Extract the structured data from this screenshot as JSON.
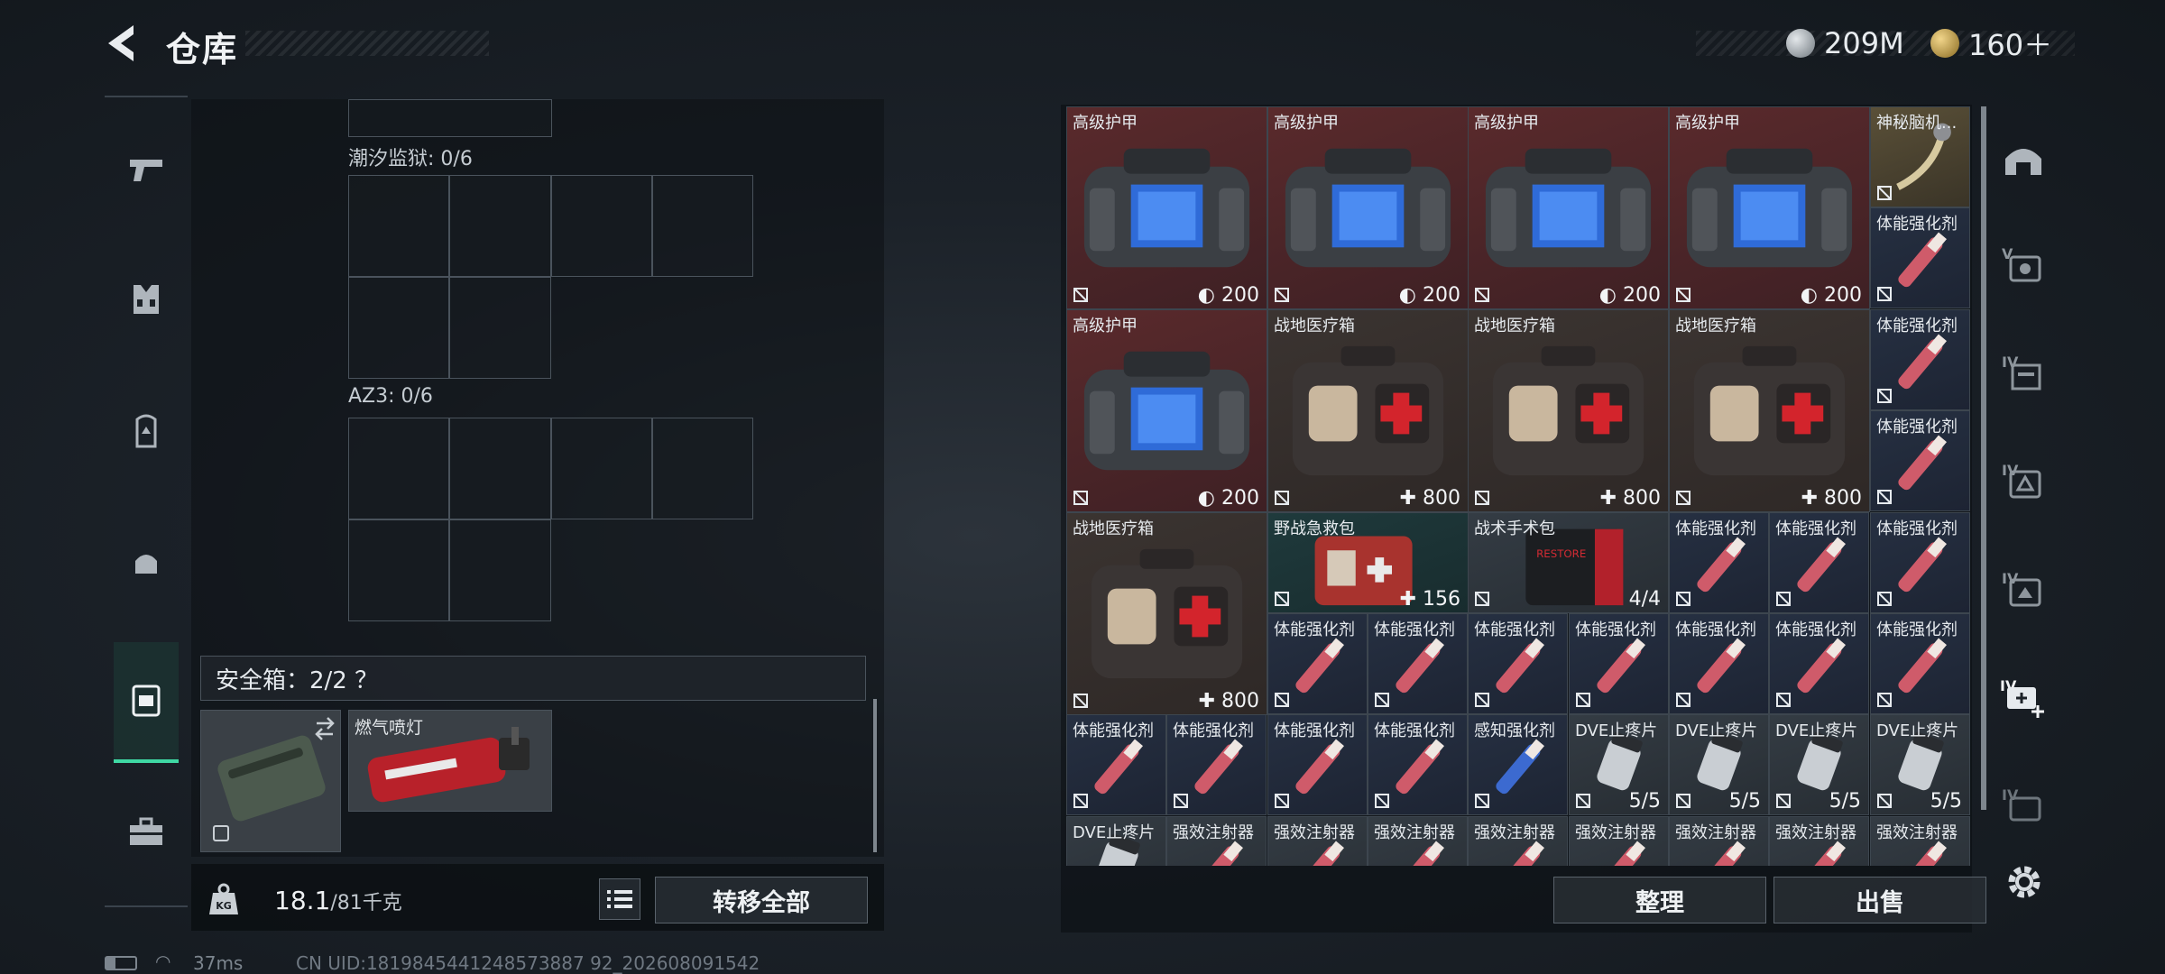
{
  "header": {
    "title": "仓库",
    "currency1": "209M",
    "currency2": "160＋",
    "currency1_color": "#9aa3ab",
    "currency2_color": "#c9a545"
  },
  "categories": [
    "pistol-icon",
    "armor-vest-icon",
    "backpack-icon",
    "helmet-bag-icon",
    "safebox-icon",
    "toolbox-icon"
  ],
  "container": {
    "section1_label": "潮汐监狱: 0/6",
    "section2_label": "AZ3: 0/6",
    "safe_box_label": "安全箱：2/2 ？",
    "torch_item": "燃气喷灯",
    "weight_value": "18.1",
    "weight_max": "/81千克",
    "transfer_button": "转移全部"
  },
  "status": {
    "ping": "37ms",
    "uid": "CN UID:1819845441248573887 92_202608091542"
  },
  "inventory": [
    {
      "name": "高级护甲",
      "value": "200",
      "value_icon": "shield",
      "color": "red",
      "kind": "armorbag"
    },
    {
      "name": "高级护甲",
      "value": "200",
      "value_icon": "shield",
      "color": "red",
      "kind": "armorbag"
    },
    {
      "name": "高级护甲",
      "value": "200",
      "value_icon": "shield",
      "color": "red",
      "kind": "armorbag"
    },
    {
      "name": "高级护甲",
      "value": "200",
      "value_icon": "shield",
      "color": "red",
      "kind": "armorbag"
    },
    {
      "name": "神秘脑机...",
      "value": "",
      "color": "gold",
      "kind": "cable"
    },
    {
      "name": "体能强化剂",
      "value": "",
      "color": "navy",
      "kind": "injector"
    },
    {
      "name": "高级护甲",
      "value": "200",
      "value_icon": "shield",
      "color": "red",
      "kind": "armorbag"
    },
    {
      "name": "战地医疗箱",
      "value": "800",
      "value_icon": "plus",
      "color": "brown",
      "kind": "medbox"
    },
    {
      "name": "战地医疗箱",
      "value": "800",
      "value_icon": "plus",
      "color": "brown",
      "kind": "medbox"
    },
    {
      "name": "战地医疗箱",
      "value": "800",
      "value_icon": "plus",
      "color": "brown",
      "kind": "medbox"
    },
    {
      "name": "体能强化剂",
      "value": "",
      "color": "navy",
      "kind": "injector"
    },
    {
      "name": "体能强化剂",
      "value": "",
      "color": "navy",
      "kind": "injector"
    },
    {
      "name": "战地医疗箱",
      "value": "800",
      "value_icon": "plus",
      "color": "brown",
      "kind": "medbox"
    },
    {
      "name": "野战急救包",
      "value": "156",
      "value_icon": "plus",
      "color": "teal",
      "kind": "firstaid"
    },
    {
      "name": "战术手术包",
      "value": "4/4",
      "value_icon": "",
      "color": "slate",
      "kind": "surgkit"
    },
    {
      "name": "体能强化剂",
      "value": "",
      "color": "navy",
      "kind": "injector"
    },
    {
      "name": "体能强化剂",
      "value": "",
      "color": "navy",
      "kind": "injector"
    },
    {
      "name": "体能强化剂",
      "value": "",
      "color": "navy",
      "kind": "injector"
    },
    {
      "name": "体能强化剂",
      "value": "",
      "color": "navy",
      "kind": "injector"
    },
    {
      "name": "体能强化剂",
      "value": "",
      "color": "navy",
      "kind": "injector"
    },
    {
      "name": "体能强化剂",
      "value": "",
      "color": "navy",
      "kind": "injector"
    },
    {
      "name": "体能强化剂",
      "value": "",
      "color": "navy",
      "kind": "injector"
    },
    {
      "name": "体能强化剂",
      "value": "",
      "color": "navy",
      "kind": "injector"
    },
    {
      "name": "体能强化剂",
      "value": "",
      "color": "navy",
      "kind": "injector"
    },
    {
      "name": "体能强化剂",
      "value": "",
      "color": "navy",
      "kind": "injector"
    },
    {
      "name": "体能强化剂",
      "value": "",
      "color": "navy",
      "kind": "injector"
    },
    {
      "name": "体能强化剂",
      "value": "",
      "color": "navy",
      "kind": "injector"
    },
    {
      "name": "体能强化剂",
      "value": "",
      "color": "navy",
      "kind": "injector"
    },
    {
      "name": "体能强化剂",
      "value": "",
      "color": "navy",
      "kind": "injector"
    },
    {
      "name": "体能强化剂",
      "value": "",
      "color": "navy",
      "kind": "injector"
    },
    {
      "name": "感知强化剂",
      "value": "",
      "color": "navy",
      "kind": "injector-blue"
    },
    {
      "name": "DVE止疼片",
      "value": "5/5",
      "color": "slate",
      "kind": "pills"
    },
    {
      "name": "DVE止疼片",
      "value": "5/5",
      "color": "slate",
      "kind": "pills"
    },
    {
      "name": "DVE止疼片",
      "value": "5/5",
      "color": "slate",
      "kind": "pills"
    },
    {
      "name": "DVE止疼片",
      "value": "5/5",
      "color": "slate",
      "kind": "pills"
    },
    {
      "name": "DVE止疼片",
      "value": "",
      "color": "slate",
      "kind": "pills"
    },
    {
      "name": "强效注射器",
      "value": "",
      "color": "slate",
      "kind": "injector"
    },
    {
      "name": "强效注射器",
      "value": "",
      "color": "slate",
      "kind": "injector"
    },
    {
      "name": "强效注射器",
      "value": "",
      "color": "slate",
      "kind": "injector"
    },
    {
      "name": "强效注射器",
      "value": "",
      "color": "slate",
      "kind": "injector"
    },
    {
      "name": "强效注射器",
      "value": "",
      "color": "slate",
      "kind": "injector"
    },
    {
      "name": "强效注射器",
      "value": "",
      "color": "slate",
      "kind": "injector"
    },
    {
      "name": "强效注射器",
      "value": "",
      "color": "slate",
      "kind": "injector"
    },
    {
      "name": "强效注射器",
      "value": "",
      "color": "slate",
      "kind": "injector"
    }
  ],
  "buttons": {
    "sort": "整理",
    "sell": "出售"
  },
  "filters": [
    "helmet-icon",
    "v-armor-icon",
    "iv-armor-icon",
    "iv-vest-icon",
    "iv-rig-icon",
    "iv-plus-icon",
    "iv-gear-icon"
  ],
  "filter_labels": [
    "V",
    "IV",
    "IV",
    "IV",
    "IV",
    "IV"
  ]
}
